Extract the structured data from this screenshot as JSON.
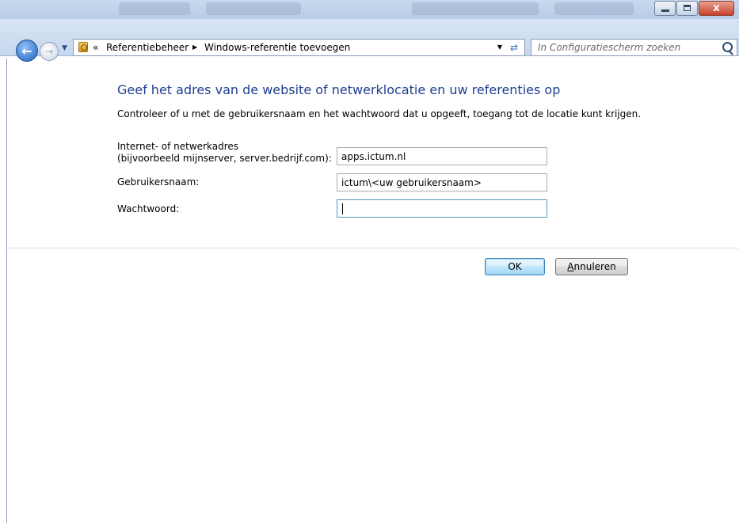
{
  "window": {
    "controls": {
      "minimize_icon": "minimize-icon",
      "maximize_icon": "maximize-icon",
      "close_glyph": "x"
    }
  },
  "nav": {
    "back_icon": "back-arrow-icon",
    "forward_icon": "forward-arrow-icon",
    "breadcrumb": {
      "overflow_glyph": "«",
      "items": [
        "Referentiebeheer",
        "Windows-referentie toevoegen"
      ],
      "separator_glyph": "▶"
    },
    "search_placeholder": "In Configuratiescherm zoeken"
  },
  "form": {
    "heading": "Geef het adres van de website of netwerklocatie en uw referenties op",
    "instruction": "Controleer of u met de gebruikersnaam en het wachtwoord dat u opgeeft, toegang tot de locatie kunt krijgen.",
    "address_label_line1": "Internet- of netwerkadres",
    "address_label_line2": "(bijvoorbeeld mijnserver, server.bedrijf.com):",
    "address_value": "apps.ictum.nl",
    "username_label": "Gebruikersnaam:",
    "username_value": "ictum\\<uw gebruikersnaam>",
    "password_label": "Wachtwoord:",
    "password_value": ""
  },
  "buttons": {
    "ok_label": "OK",
    "cancel_mnemonic": "A",
    "cancel_rest": "nnuleren"
  }
}
